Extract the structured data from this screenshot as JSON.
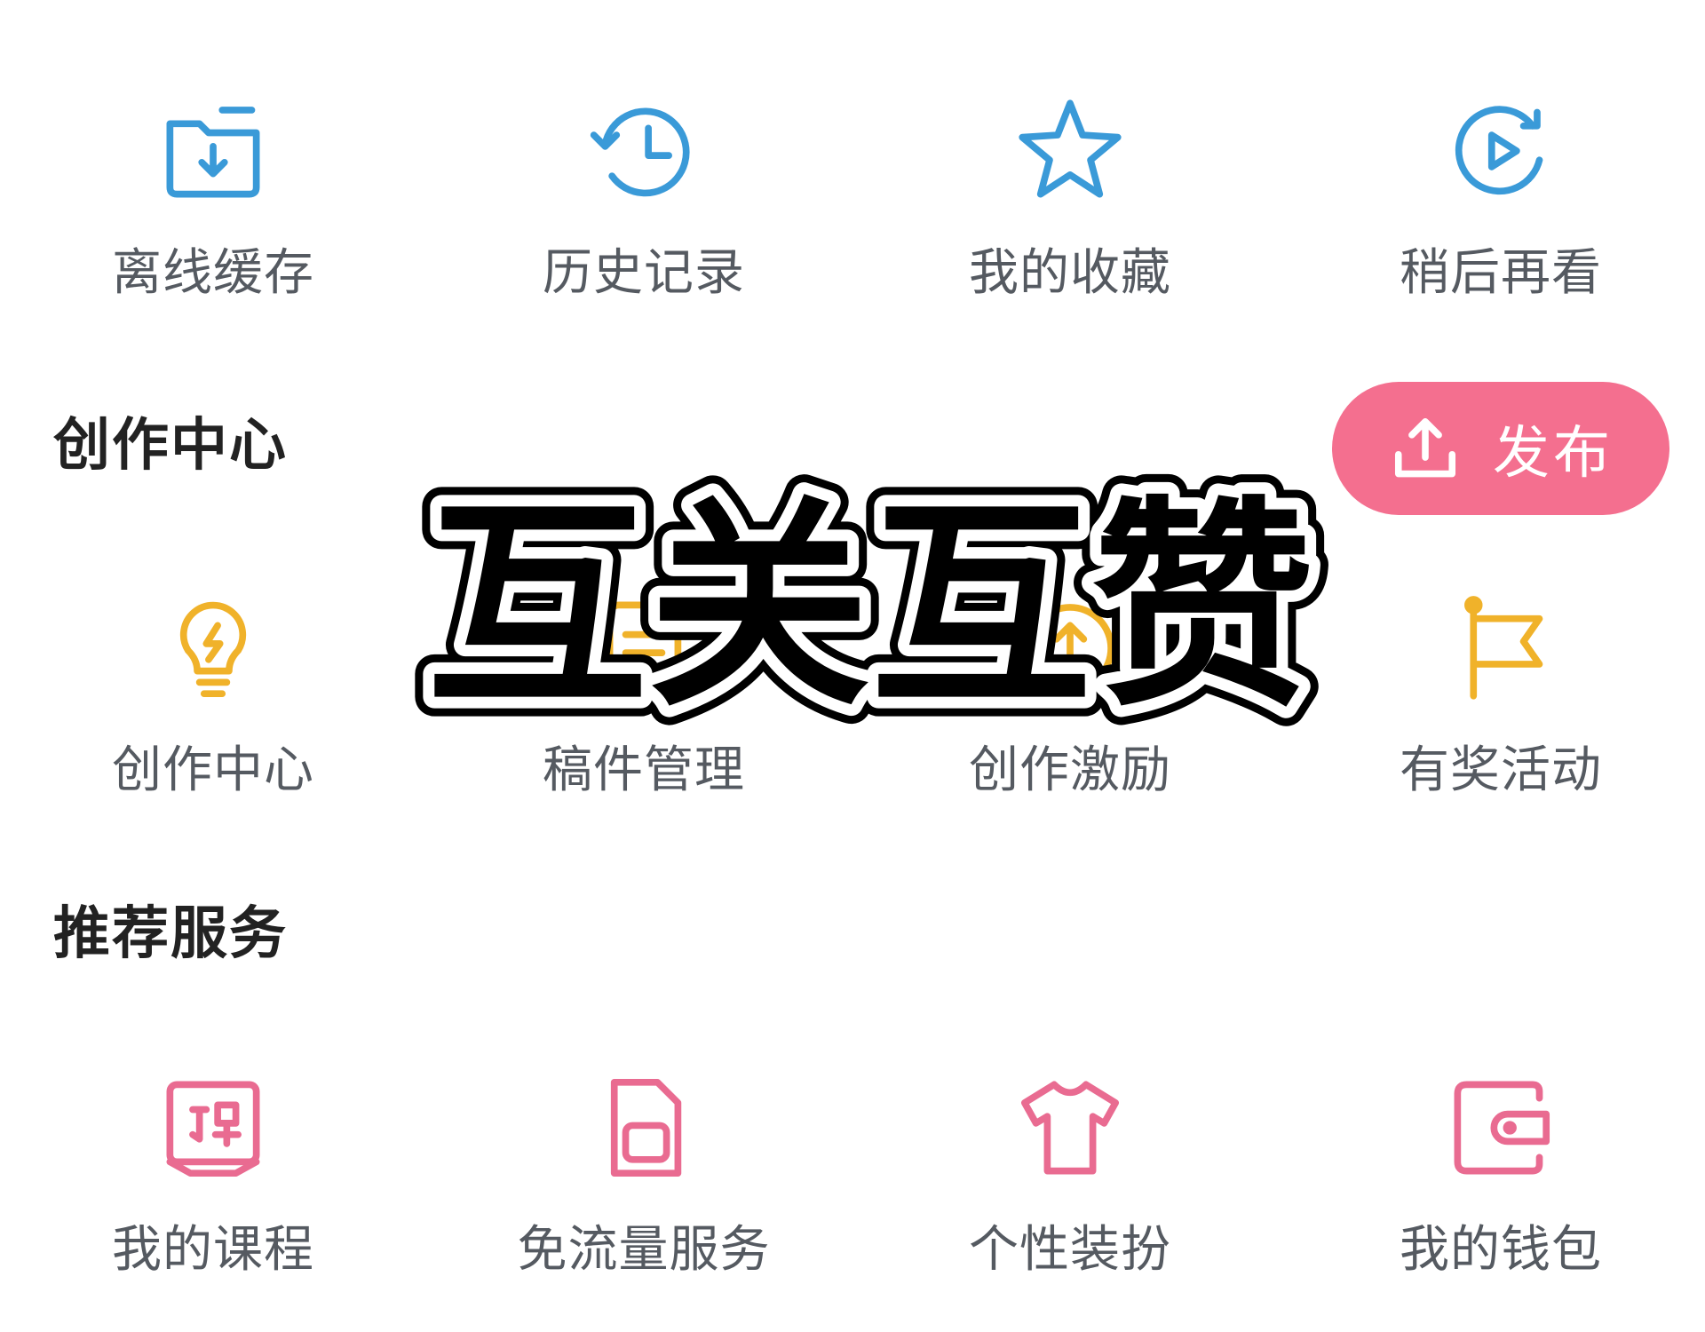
{
  "menu_row_1": [
    {
      "label": "离线缓存",
      "icon": "download-folder-icon",
      "color": "#3a9ad8"
    },
    {
      "label": "历史记录",
      "icon": "history-clock-icon",
      "color": "#3a9ad8"
    },
    {
      "label": "我的收藏",
      "icon": "star-icon",
      "color": "#3a9ad8"
    },
    {
      "label": "稍后再看",
      "icon": "play-later-icon",
      "color": "#3a9ad8"
    }
  ],
  "creation": {
    "section_title": "创作中心",
    "publish_label": "发布",
    "publish_icon": "upload-icon",
    "publish_color": "#f46f8f",
    "items": [
      {
        "label": "创作中心",
        "icon": "lightbulb-icon",
        "color": "#f0b22a"
      },
      {
        "label": "稿件管理",
        "icon": "manuscript-icon",
        "color": "#f0b22a"
      },
      {
        "label": "创作激励",
        "icon": "incentive-icon",
        "color": "#f0b22a"
      },
      {
        "label": "有奖活动",
        "icon": "flag-icon",
        "color": "#f0b22a"
      }
    ]
  },
  "services": {
    "section_title": "推荐服务",
    "items": [
      {
        "label": "我的课程",
        "icon": "course-book-icon",
        "color": "#e96b91"
      },
      {
        "label": "免流量服务",
        "icon": "sim-card-icon",
        "color": "#e96b91"
      },
      {
        "label": "个性装扮",
        "icon": "tshirt-icon",
        "color": "#e96b91"
      },
      {
        "label": "我的钱包",
        "icon": "wallet-icon",
        "color": "#e96b91"
      }
    ]
  },
  "overlay_text": "互关互赞"
}
